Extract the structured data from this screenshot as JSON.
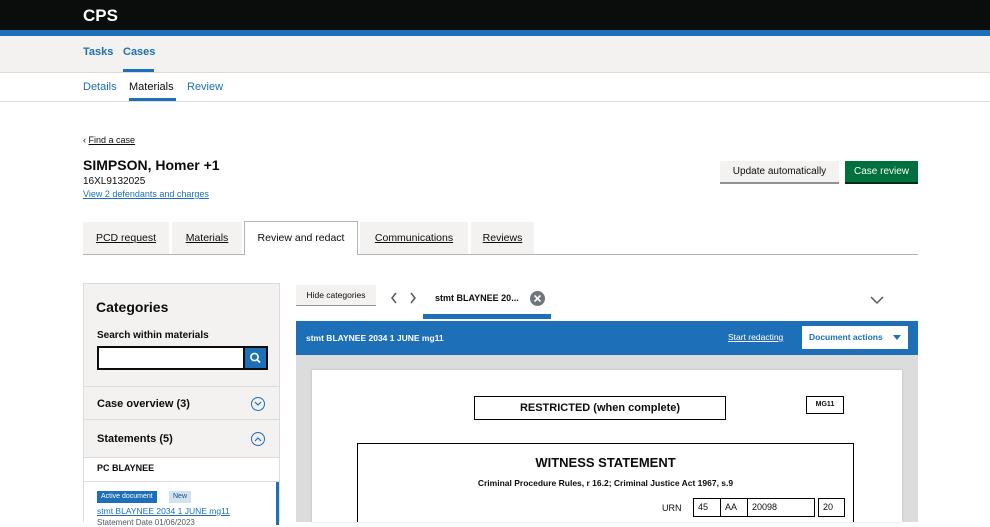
{
  "header": {
    "logo": "CPS"
  },
  "nav": {
    "primary": [
      "Tasks",
      "Cases"
    ],
    "secondary": [
      "Details",
      "Materials",
      "Review"
    ]
  },
  "case": {
    "back_label": "Find a case",
    "title": "SIMPSON, Homer +1",
    "urn": "16XL9132025",
    "defendants_link": "View 2 defendants and charges"
  },
  "actions": {
    "update": "Update automatically",
    "case_review": "Case review"
  },
  "tabs": [
    "PCD request",
    "Materials",
    "Review and redact",
    "Communications",
    "Reviews"
  ],
  "categories": {
    "title": "Categories",
    "search_label": "Search within materials",
    "search_value": "",
    "sections": [
      "Case overview (3)",
      "Statements (5)"
    ],
    "group": "PC BLAYNEE",
    "tag_active": "Active document",
    "tag_new": "New",
    "doc_link": "stmt BLAYNEE 2034 1 JUNE mg11",
    "doc_meta": "Statement Date 01/06/2023"
  },
  "viewer": {
    "hide_categories": "Hide categories",
    "tab_label": "stmt BLAYNEE 20...",
    "title": "stmt BLAYNEE 2034 1 JUNE mg11",
    "start_redacting": "Start redacting",
    "document_actions": "Document actions"
  },
  "document": {
    "restricted": "RESTRICTED (when complete)",
    "form": "MG11",
    "heading": "WITNESS STATEMENT",
    "subheading": "Criminal Procedure Rules, r 16.2; Criminal Justice Act 1967, s.9",
    "urn_label": "URN",
    "urn_parts": [
      "45",
      "AA",
      "20098",
      "20"
    ]
  },
  "colors": {
    "brand_blue": "#1d70b8",
    "green": "#00703c",
    "black": "#0b0c0c"
  }
}
